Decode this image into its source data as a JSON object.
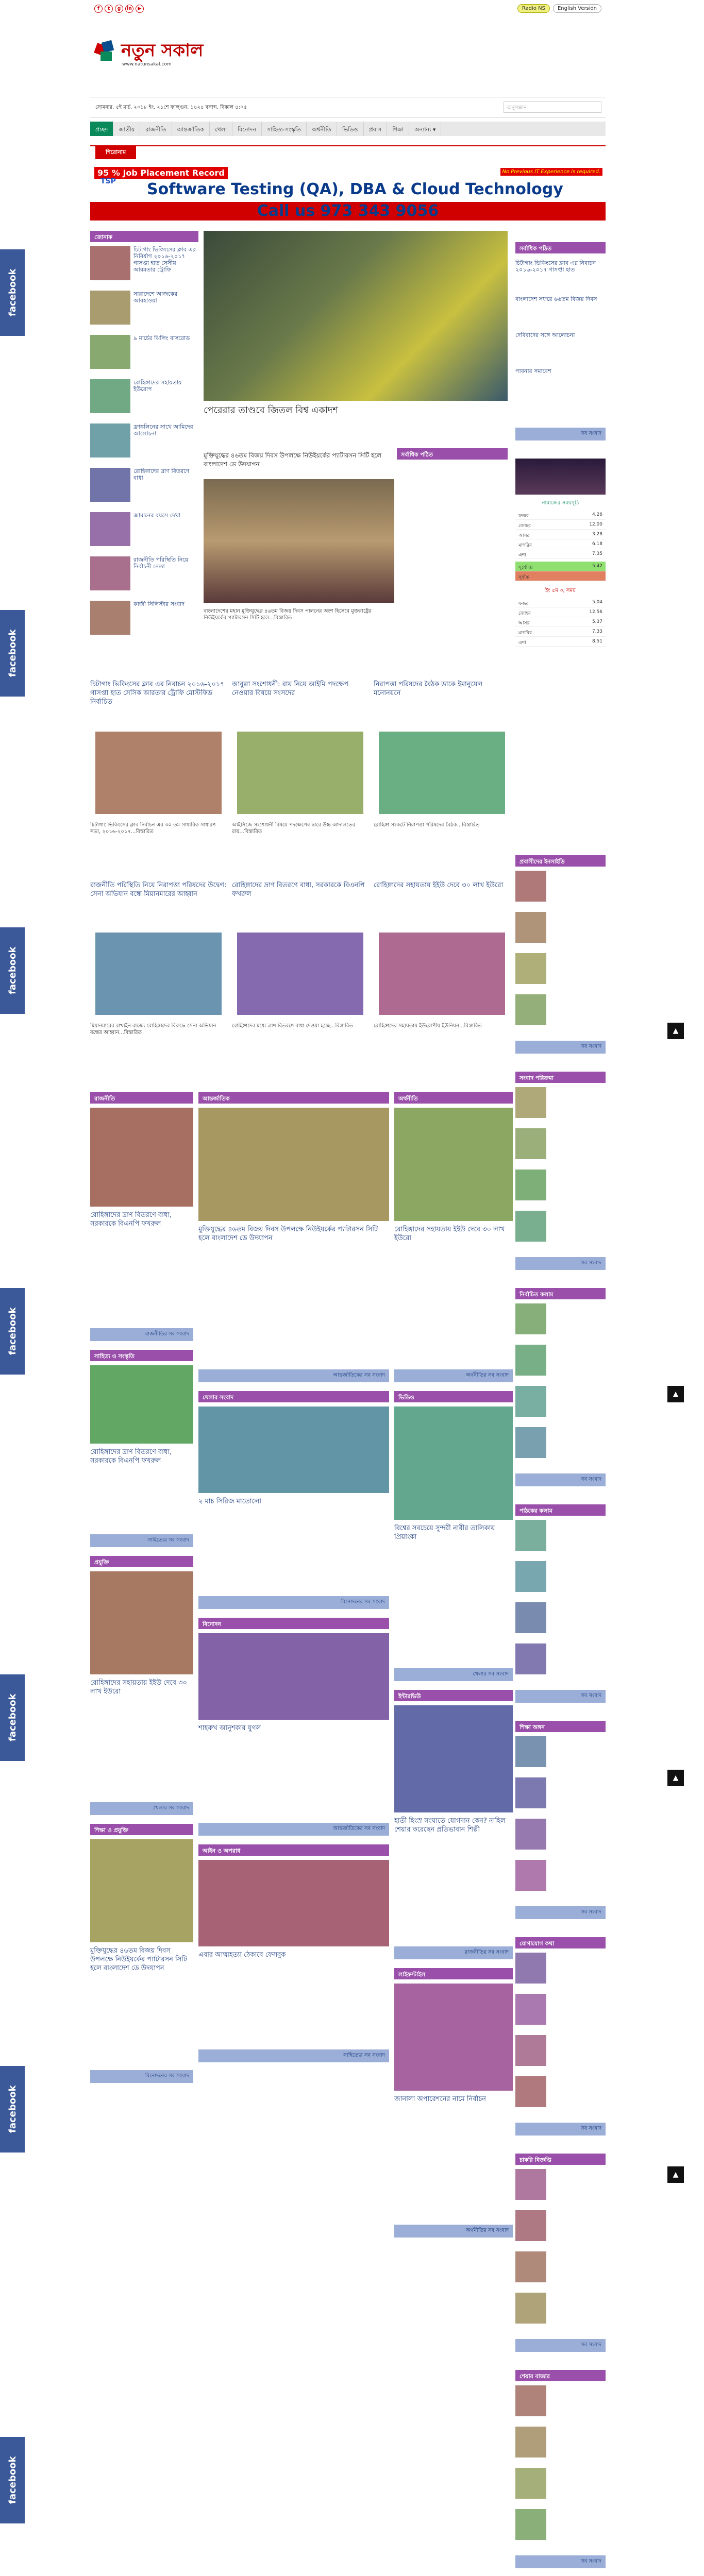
{
  "header": {
    "radio_label": "Radio NS",
    "english_label": "English Version",
    "logo_text": "নতুন সকাল",
    "logo_url": "www.natunsakal.com",
    "date_line": "সোমবার, ৫ই মার্চ, ২০১৮ ইং, ২১শে ফাল্গুন, ১৪২৪ বঙ্গাব্দ, বিকাল ৪:০৫",
    "search_placeholder": "অনুসন্ধান"
  },
  "nav": [
    "প্রচ্ছদ",
    "জাতীয়",
    "রাজনীতি",
    "আন্তর্জাতিক",
    "খেলা",
    "বিনোদন",
    "সাহিত্য-সংস্কৃতি",
    "অর্থনীতি",
    "ভিডিও",
    "প্রবাস",
    "শিক্ষা",
    "অন্যান্য ▾"
  ],
  "breaking_label": "শিরোনাম",
  "ad": {
    "line1": "95 % Job Placement Record",
    "note": "No Previous IT Experience is required.",
    "line2": "Software Testing (QA), DBA & Cloud Technology",
    "brand": "TSP",
    "line3": "Call us 973 343 9056"
  },
  "left_sections": {
    "trending_title": "জোনাক",
    "items": [
      "চিটাগাং ভিকিংসের ক্লাব এর নিবির্যাগ ২০১৬-২০১৭ গাসপ্তা হাত সেসীয় আরমতার ট্রোফি",
      "সারাদেশে আজকের আবহাওয়া",
      "৯ মার্চের ঝিলিং বাসরোড",
      "রোহিঙ্গাদের সহায়তায় ইউরোপ",
      "ফ্রাঙ্কলিনের সাথে আমিদের আলোচনা",
      "রোহিঙ্গাদের দ্রাণ বিতরণে বাধা",
      "জামানের বয়সে দেখা",
      "রাজনীতি পরিস্থিতি নিয়ে নির্বাচনী নেতা",
      "কাজী সিলিস্টার সংবাদ"
    ]
  },
  "lead": {
    "headline": "পেরেরার তাণ্ডবে জিতল বিশ্ব একাদশ"
  },
  "popular_title": "সর্বাধিক পঠিত",
  "popular_items": [
    "চিটাগাং ভিকিংসের ক্লাব এর নিবাচন ২০১৬-২০১৭ গাসপ্তা হাত",
    "বাংলাদেশ সফরে ৬৬তম বিজয় দিবস",
    "দেবিবাদের সঙ্গে আলোচনা",
    "পাবনার সমাবেশ"
  ],
  "see_more": "সব সংবাদ",
  "prayer": {
    "title": "নামাজের সময়সূচি",
    "rows": [
      [
        "ফজর",
        "4.26"
      ],
      [
        "জোহর",
        "12.00"
      ],
      [
        "আসর",
        "3.28"
      ],
      [
        "মাগরিব",
        "6.18"
      ],
      [
        "এশা",
        "7.35"
      ]
    ],
    "sunrise_label": "সূর্যোদয়",
    "sunrise": "5.42",
    "sunset_label": "সূর্যাস্ত"
  },
  "prayer2": {
    "title": "ইং ৫ম ৩, সময়",
    "rows": [
      [
        "ফজর",
        "5.04"
      ],
      [
        "জোহর",
        "12.56"
      ],
      [
        "আসর",
        "5.37"
      ],
      [
        "মাগরিব",
        "7.33"
      ],
      [
        "এশা",
        "8.51"
      ]
    ],
    "sunrise": "6.23"
  },
  "feature": {
    "title": "মুক্তিযুদ্ধের ৪৬তম বিজয় দিবস উপলক্ষে নিউইয়র্কের প্যাটারসন সিটি হলে বাংলাদেশ ডে উদযাপন",
    "body": "বাংলাদেশের মহান মুক্তিযুদ্ধের ৪৬তম বিজয় দিবস পালনের অংশ হিসেবে মুক্তরাষ্ট্রের নিউইয়র্কের প্যাটারসন সিটি হলে...বিস্তারিত"
  },
  "grid": [
    {
      "title": "চিটাগাং ভিকিংসের ক্লাব এর নিবাচন ২০১৬-২০১৭ গাসপ্তা হাত সেসিক আরতার ট্রোফি মোস্টফিড নির্বাচিত",
      "body": "চিটাগাং ভিকিংসের ক্লাব নির্বাচন এর ৩০ তম সাধারিক সাধারণ সভা, ২০১৬-২০১৭...বিস্তারিত"
    },
    {
      "title": "আবুল্লা সংশোধনী: রায় নিয়ে আইমি পদক্ষেপ নেওয়ার বিষয়ে সংসদের",
      "body": "আইসিজে সংশোধনী বিষয়ে পদক্ষেপের দ্বারে উচ্চ আদালতের রায়...বিস্তারিত"
    },
    {
      "title": "নিরাপত্তা পরিষদের বৈঠক ডাকে ইমানুয়েল মনোনয়নে",
      "body": "রোহিঙ্গা সংকটে নিরাপত্তা পরিষদের বৈঠক...বিস্তারিত"
    },
    {
      "title": "রাজনীতি পরিস্থিতি নিয়ে নিরাপত্তা পরিষদের উদ্বেগ: সেনা অভিযান বন্ধে মিয়ানমারের আহ্বান",
      "body": "মিয়ানমারের রাখাইন রাজ্যে রোহিঙ্গাদের বিরুদ্ধে সেনা অভিযান বন্ধের আহ্বান...বিস্তারিত"
    },
    {
      "title": "রোহিঙ্গাদের দ্রাণ বিতরণে বাধা, সরকারকে বিএনপি ফখরুল",
      "body": "রোহিঙ্গাদের মধ্যে ত্রাণ বিতরণে বাধা দেওয়া হচ্ছে...বিস্তারিত"
    },
    {
      "title": "রোহিঙ্গাদের সহায়তায় ইইউ দেবে ৩০ লাখ ইউরো",
      "body": "রোহিঙ্গাদের সহায়তায় ইউরোপীয় ইউনিয়ন...বিস্তারিত"
    }
  ],
  "sections": [
    {
      "title": "রাজনীতি"
    },
    {
      "title": "আন্তর্জাতিক"
    },
    {
      "title": "অর্থনীতি"
    },
    {
      "title": "সাহিত্য ও সংস্কৃতি"
    },
    {
      "title": "ভিডিও"
    },
    {
      "title": "খেলার সংবাদ"
    },
    {
      "title": "ইন্টারভিউ"
    },
    {
      "title": "বিনোদন"
    },
    {
      "title": "লাইফস্টাইল"
    },
    {
      "title": "আইন ও অপরাধ"
    },
    {
      "title": "প্রযুক্তি"
    },
    {
      "title": "শিক্ষা ও প্রযুক্তি"
    }
  ],
  "right_sections": [
    {
      "title": "প্রবাসীদের ইনসাইডি"
    },
    {
      "title": "সংবাদ পরিক্রমা"
    },
    {
      "title": "নির্বাচিত কলাম"
    },
    {
      "title": "পাঠকের কলাম"
    },
    {
      "title": "শিক্ষা অঙ্গন"
    },
    {
      "title": "যোগাযোগ কথা"
    },
    {
      "title": "চাকরি বিজ্ঞপ্তি"
    },
    {
      "title": "শেয়ার বাজার"
    }
  ],
  "section_texts": {
    "rajniti": "রোহিঙ্গাদের দ্রাণ বিতরণে বাধা, সরকারকে বিএনপি ফখরুল",
    "antorjatik": "মুক্তিযুদ্ধের ৪৬তম বিজয় দিবস উপলক্ষে নিউইয়র্কের প্যাটারসন সিটি হলে বাংলাদেশ ডে উদযাপন",
    "orthoniti": "রোহিঙ্গাদের সহায়তায় ইইউ দেবে ৩০ লাখ ইউরো",
    "video": "বিশ্বের সবচেয়ে সুন্দরী নারীর তালিকায় প্রিয়াংকা",
    "khela": "২ মাচ সিরিজ মাতোলো",
    "interview": "হাতী হিংস্র সংঘাতে যোগদান কেন? নাহিল শেয়ার করেছেন প্রতিভাবান শিল্পী",
    "binodon": "শাহরুখ আনুশকার যুগল",
    "lifestyle": "জানালা অপারেশনের নামে নির্বাচন",
    "ain": "এবার আত্মহত্যা ঠেকাবে ফেসবুক"
  },
  "more_labels": [
    "রাজনীতির সব সংবাদ",
    "আন্তর্জাতিকের সব সংবাদ",
    "অর্থনীতির সব সংবাদ",
    "সাহিত্যের সব সংবাদ",
    "খেলার সব সংবাদ",
    "বিনোদনের সব সংবাদ"
  ],
  "facebook_label": "facebook",
  "colors": {
    "section": "#9a50aa",
    "more_bar": "#9aaed8",
    "brand_red": "#d10000",
    "nav_active": "#0a8a5a",
    "facebook": "#3b5998"
  }
}
